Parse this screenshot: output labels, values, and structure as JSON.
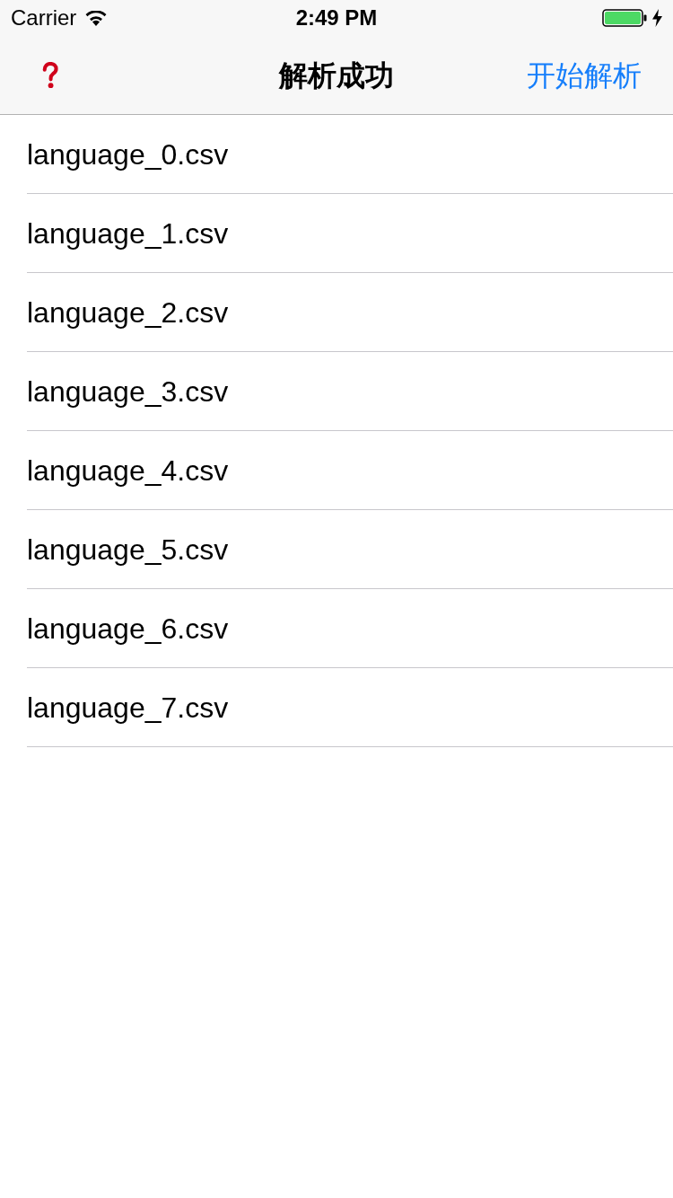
{
  "status_bar": {
    "carrier": "Carrier",
    "time": "2:49 PM"
  },
  "nav_bar": {
    "title": "解析成功",
    "right_button": "开始解析"
  },
  "files": [
    "language_0.csv",
    "language_1.csv",
    "language_2.csv",
    "language_3.csv",
    "language_4.csv",
    "language_5.csv",
    "language_6.csv",
    "language_7.csv"
  ]
}
